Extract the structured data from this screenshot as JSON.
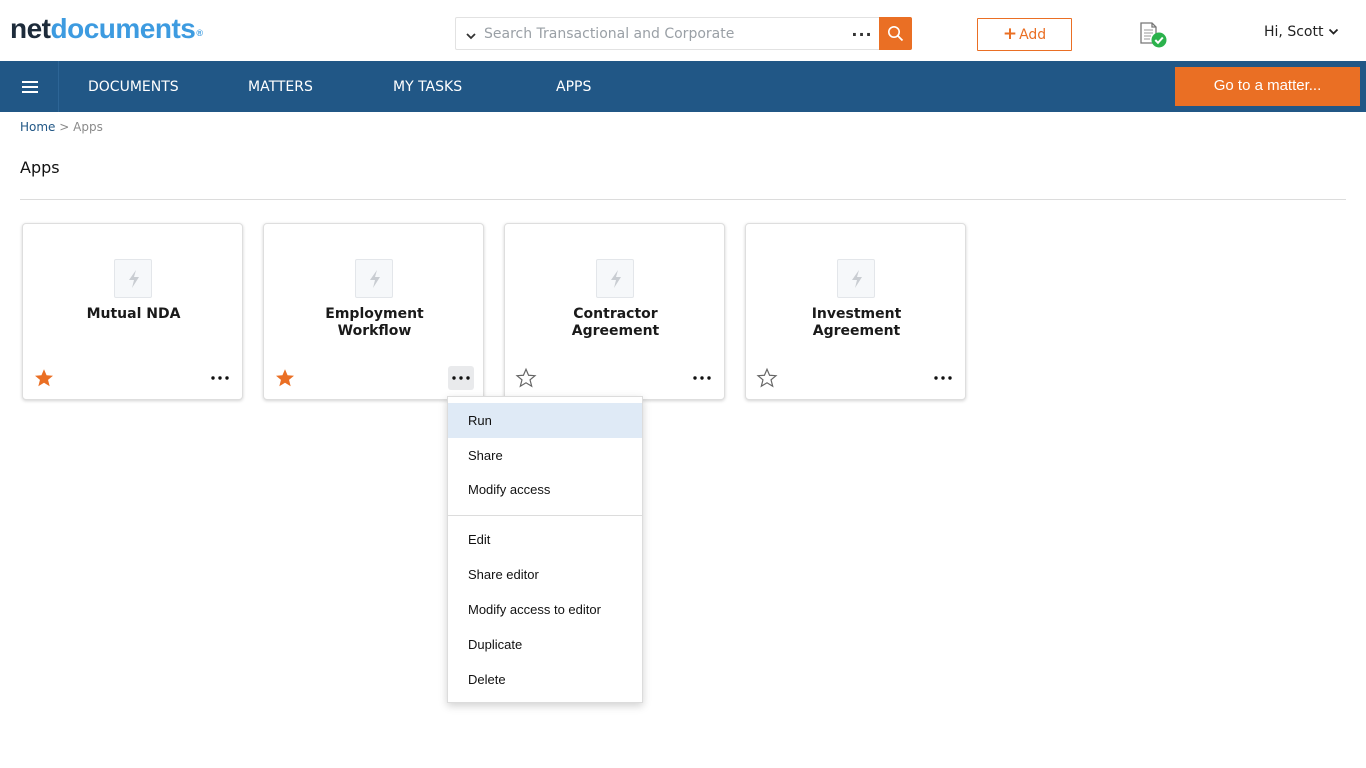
{
  "header": {
    "logo": {
      "part1": "net",
      "part2": "documents",
      "mark": "®"
    },
    "search": {
      "placeholder": "Search Transactional and Corporate",
      "more": "..."
    },
    "add_label": "Add",
    "greeting": "Hi,  Scott"
  },
  "nav": {
    "items": [
      {
        "label": "DOCUMENTS"
      },
      {
        "label": "MATTERS"
      },
      {
        "label": "MY TASKS"
      },
      {
        "label": "APPS"
      }
    ],
    "go_to_matter": "Go to a matter..."
  },
  "breadcrumb": {
    "home": "Home",
    "separator": ">",
    "current": "Apps"
  },
  "page_title": "Apps",
  "apps": [
    {
      "line1": "Mutual NDA",
      "line2": "",
      "favorite": true
    },
    {
      "line1": "Employment",
      "line2": "Workflow",
      "favorite": true
    },
    {
      "line1": "Contractor",
      "line2": "Agreement",
      "favorite": false
    },
    {
      "line1": "Investment",
      "line2": "Agreement",
      "favorite": false
    }
  ],
  "context_menu": {
    "items": [
      {
        "label": "Run",
        "highlighted": true
      },
      {
        "label": "Share"
      },
      {
        "label": "Modify access"
      },
      {
        "label": "Edit"
      },
      {
        "label": "Share editor"
      },
      {
        "label": "Modify access to editor"
      },
      {
        "label": "Duplicate"
      },
      {
        "label": "Delete"
      }
    ]
  },
  "colors": {
    "brand_dark": "#1d2b3a",
    "brand_light": "#3d9be0",
    "nav_bg": "#215786",
    "accent": "#ea6f24",
    "status_green": "#2bb24c",
    "menu_highlight": "#dfeaf6"
  },
  "icons": {
    "search_scope": "chevron-down-icon",
    "search_submit": "search-icon",
    "doc_status": "document-check-icon",
    "menu": "hamburger-icon",
    "app": "lightning-icon",
    "favorite": "star-icon",
    "more": "ellipsis-icon"
  }
}
